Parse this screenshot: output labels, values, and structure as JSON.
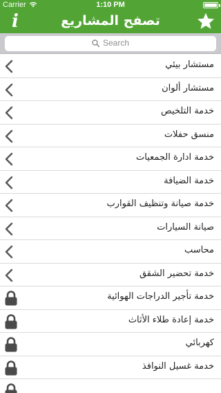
{
  "status_bar": {
    "carrier": "Carrier",
    "time": "1:10 PM"
  },
  "header": {
    "title": "تصفح المشاريع",
    "info_label": "i",
    "accent_color": "#52a535"
  },
  "search": {
    "placeholder": "Search"
  },
  "list": {
    "items": [
      {
        "label": "مستشار بيئي",
        "state": "chevron"
      },
      {
        "label": "مستشار ألوان",
        "state": "chevron"
      },
      {
        "label": "خدمة التلخيص",
        "state": "chevron"
      },
      {
        "label": "منسق حفلات",
        "state": "chevron"
      },
      {
        "label": "خدمة ادارة الجمعيات",
        "state": "chevron"
      },
      {
        "label": "خدمة الضيافة",
        "state": "chevron"
      },
      {
        "label": "خدمة صيانة وتنظيف القوارب",
        "state": "chevron"
      },
      {
        "label": "صيانة السيارات",
        "state": "chevron"
      },
      {
        "label": "محاسب",
        "state": "chevron"
      },
      {
        "label": "خدمة تحضير الشقق",
        "state": "chevron"
      },
      {
        "label": "خدمة تأجير الدراجات الهوائية",
        "state": "locked"
      },
      {
        "label": "خدمة إعادة طلاء الأثاث",
        "state": "locked"
      },
      {
        "label": "كهربائي",
        "state": "locked"
      },
      {
        "label": "خدمة غسيل النوافذ",
        "state": "locked"
      },
      {
        "label": "",
        "state": "locked"
      }
    ]
  }
}
